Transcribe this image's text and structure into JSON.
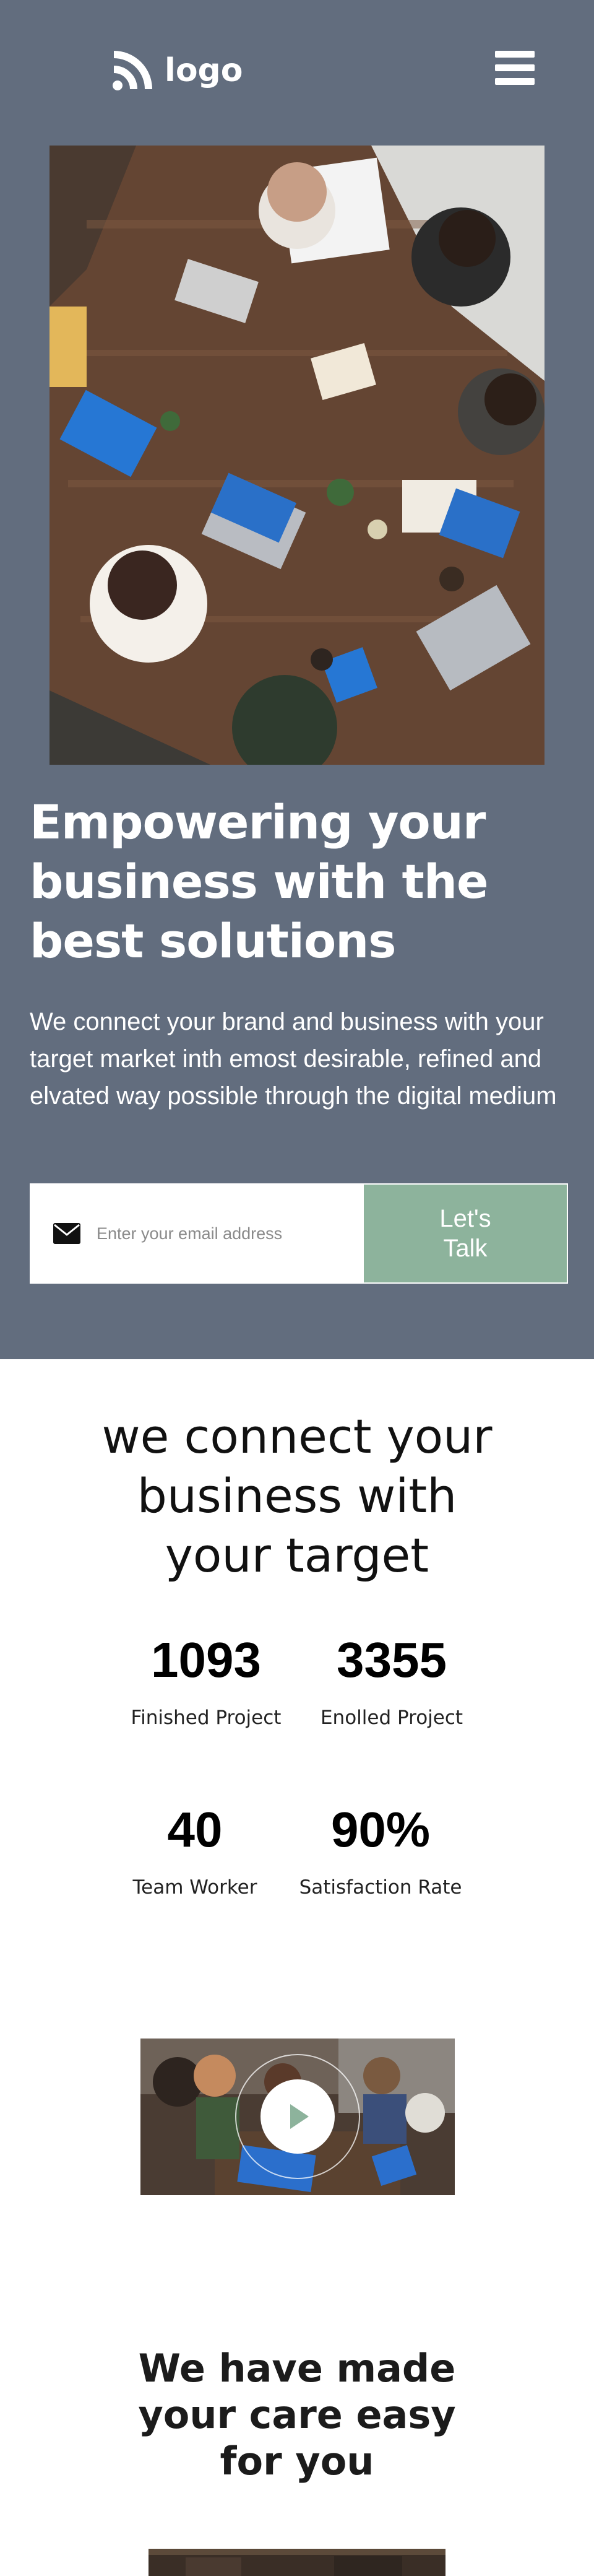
{
  "nav": {
    "logo_text": "logo",
    "logo_icon": "rss-feed-icon",
    "menu_icon": "hamburger-menu-icon"
  },
  "hero": {
    "image": "team meeting at wooden table with laptops, top-down photo",
    "title": "Empowering your business with the best solutions",
    "description": "We connect your brand and business with your target market inth emost desirable, refined and elvated way possible through the digital medium",
    "email_placeholder": "Enter your email address",
    "email_icon": "envelope-icon",
    "cta_label": "Let's Talk"
  },
  "stats": {
    "heading": "we connect your business with your target",
    "items": [
      {
        "value": "1093",
        "label": "Finished Project"
      },
      {
        "value": "3355",
        "label": "Enolled Project"
      },
      {
        "value": "40",
        "label": "Team Worker"
      },
      {
        "value": "90%",
        "label": "Satisfaction Rate"
      }
    ]
  },
  "video": {
    "thumbnail": "team collaborating around a table with laptops",
    "play_icon": "play-icon"
  },
  "care": {
    "heading": "We have made your care easy for you"
  },
  "colors": {
    "hero_bg": "#626d7e",
    "accent": "#8db39c",
    "text_dark": "#111111",
    "white": "#ffffff"
  }
}
